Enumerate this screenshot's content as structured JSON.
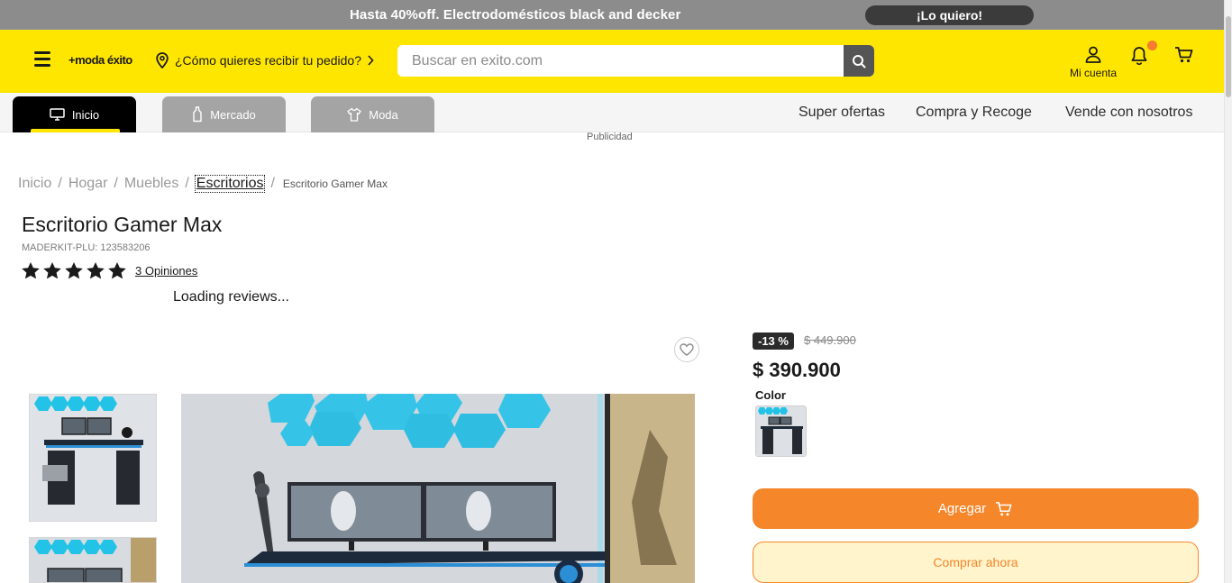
{
  "promo": {
    "text": "Hasta 40%off. Electrodomésticos black and decker",
    "cta_label": "¡Lo quiero!"
  },
  "header": {
    "logo_text": "+moda éxito",
    "delivery_label": "¿Cómo quieres recibir tu pedido?",
    "search_placeholder": "Buscar en exito.com",
    "account_label": "Mi cuenta",
    "notification_dot_color": "#f47b30"
  },
  "nav": {
    "tabs": [
      {
        "label": "Inicio",
        "icon": "monitor-icon",
        "active": true
      },
      {
        "label": "Mercado",
        "icon": "bottle-icon",
        "active": false
      },
      {
        "label": "Moda",
        "icon": "shirt-icon",
        "active": false
      }
    ],
    "links": [
      "Super ofertas",
      "Compra y Recoge",
      "Vende con nosotros"
    ]
  },
  "ad_label": "Publicidad",
  "breadcrumb": {
    "items": [
      "Inicio",
      "Hogar",
      "Muebles",
      "Escritorios"
    ],
    "current": "Escritorio Gamer Max"
  },
  "product": {
    "title": "Escritorio Gamer Max",
    "sku": "MADERKIT-PLU: 123583206",
    "rating_stars": 5,
    "opinions_label": "3 Opiniones",
    "loading_reviews": "Loading reviews...",
    "discount": "-13 %",
    "old_price": "$ 449.900",
    "price": "$ 390.900",
    "color_label": "Color",
    "add_button": "Agregar",
    "buy_button": "Comprar ahora"
  },
  "colors": {
    "brand_yellow": "#ffe600",
    "accent_orange": "#f6862a",
    "buy_bg": "#fff4cc",
    "promo_bg": "#8c8c8c"
  }
}
